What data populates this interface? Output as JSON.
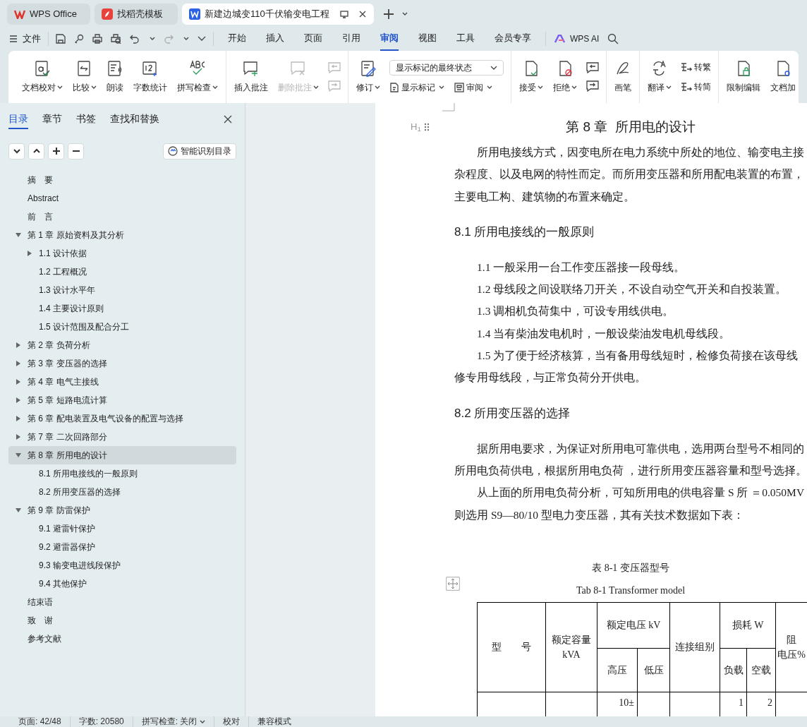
{
  "tabs": [
    {
      "label": "WPS Office",
      "kind": "home",
      "selected": false
    },
    {
      "label": "找稻壳模板",
      "kind": "template",
      "selected": false
    },
    {
      "label": "新建边城变110千伏输变电工程",
      "kind": "document",
      "selected": true
    }
  ],
  "menu": {
    "file": "文件",
    "ribbon_tabs": [
      {
        "label": "开始",
        "selected": false
      },
      {
        "label": "插入",
        "selected": false
      },
      {
        "label": "页面",
        "selected": false
      },
      {
        "label": "引用",
        "selected": false
      },
      {
        "label": "审阅",
        "selected": true
      },
      {
        "label": "视图",
        "selected": false
      },
      {
        "label": "工具",
        "selected": false
      },
      {
        "label": "会员专享",
        "selected": false
      }
    ],
    "ai": "WPS AI"
  },
  "ribbon": [
    {
      "items": [
        {
          "kind": "large",
          "label": "文档校对",
          "dropdown": true,
          "disabled": false
        },
        {
          "kind": "large",
          "label": "比较",
          "dropdown": true,
          "disabled": false
        },
        {
          "kind": "large",
          "label": "朗读",
          "dropdown": false,
          "disabled": false
        },
        {
          "kind": "large",
          "label": "字数统计",
          "dropdown": false,
          "disabled": false
        },
        {
          "kind": "large",
          "label": "拼写检查",
          "dropdown": true,
          "disabled": false
        }
      ]
    },
    {
      "items": [
        {
          "kind": "large",
          "label": "插入批注",
          "dropdown": false,
          "disabled": false
        },
        {
          "kind": "large",
          "label": "删除批注",
          "dropdown": true,
          "disabled": true
        },
        {
          "kind": "pair",
          "disabled": true
        }
      ]
    },
    {
      "items": [
        {
          "kind": "large",
          "label": "修订",
          "dropdown": true,
          "disabled": false
        },
        {
          "kind": "stack",
          "select": "显示标记的最终状态",
          "buttons": [
            {
              "label": "显示标记"
            },
            {
              "label": "审阅"
            }
          ]
        }
      ]
    },
    {
      "items": [
        {
          "kind": "large",
          "label": "接受",
          "dropdown": true,
          "disabled": false
        },
        {
          "kind": "large",
          "label": "拒绝",
          "dropdown": true,
          "disabled": false
        },
        {
          "kind": "pair",
          "disabled": false
        }
      ]
    },
    {
      "items": [
        {
          "kind": "large",
          "label": "画笔",
          "dropdown": false,
          "disabled": false
        }
      ]
    },
    {
      "items": [
        {
          "kind": "large",
          "label": "翻译",
          "dropdown": true,
          "disabled": false
        },
        {
          "kind": "stack2",
          "buttons": [
            {
              "label": "转繁"
            },
            {
              "label": "转简"
            }
          ]
        }
      ]
    },
    {
      "items": [
        {
          "kind": "large",
          "label": "限制编辑",
          "dropdown": false,
          "disabled": false
        },
        {
          "kind": "large",
          "label": "文档加",
          "dropdown": false,
          "disabled": false
        }
      ]
    }
  ],
  "sidebar": {
    "tabs": [
      {
        "label": "目录",
        "selected": true
      },
      {
        "label": "章节",
        "selected": false
      },
      {
        "label": "书签",
        "selected": false
      },
      {
        "label": "查找和替换",
        "selected": false
      }
    ],
    "smart_button": "智能识别目录",
    "toc": [
      {
        "label": "摘　要",
        "selected": false
      },
      {
        "label": "Abstract",
        "selected": false
      },
      {
        "label": "前　言",
        "selected": false
      },
      {
        "label": "第 1 章  原始资料及其分析",
        "selected": false,
        "expanded": true,
        "children": [
          {
            "label": "1.1 设计依据",
            "selected": false,
            "expanded": false
          },
          {
            "label": "1.2 工程概况",
            "selected": false
          },
          {
            "label": "1.3 设计水平年",
            "selected": false
          },
          {
            "label": "1.4  主要设计原则",
            "selected": false
          },
          {
            "label": "1.5 设计范围及配合分工",
            "selected": false
          }
        ]
      },
      {
        "label": "第 2 章  负荷分析",
        "selected": false,
        "expanded": false
      },
      {
        "label": "第 3 章  变压器的选择",
        "selected": false,
        "expanded": false
      },
      {
        "label": "第 4 章  电气主接线",
        "selected": false,
        "expanded": false
      },
      {
        "label": "第 5 章  短路电流计算",
        "selected": false,
        "expanded": false
      },
      {
        "label": "第 6 章  配电装置及电气设备的配置与选择",
        "selected": false,
        "expanded": false
      },
      {
        "label": "第 7 章  二次回路部分",
        "selected": false,
        "expanded": false
      },
      {
        "label": "第 8 章  所用电的设计",
        "selected": true,
        "expanded": true,
        "children": [
          {
            "label": "8.1 所用电接线的一般原则",
            "selected": false
          },
          {
            "label": "8.2 所用变压器的选择",
            "selected": false
          }
        ]
      },
      {
        "label": "第 9 章  防雷保护",
        "selected": false,
        "expanded": true,
        "children": [
          {
            "label": "9.1 避雷针保护",
            "selected": false
          },
          {
            "label": "9.2 避雷器保护",
            "selected": false
          },
          {
            "label": "9.3 输变电进线段保护",
            "selected": false
          },
          {
            "label": "9.4 其他保护",
            "selected": false
          }
        ]
      },
      {
        "label": "结束语",
        "selected": false
      },
      {
        "label": "致　谢",
        "selected": false
      },
      {
        "label": "参考文献",
        "selected": false
      }
    ]
  },
  "document": {
    "heading_marker": "H$_{1}$",
    "title": "第 8 章  所用电的设计",
    "blocks": [
      {
        "kind": "para",
        "lines": [
          "所用电接线方式，因变电所在电力系统中所处的地位、输变电主接",
          "杂程度、以及电网的特性而定。而所用变压器和所用配电装置的布置，",
          "主要电工构、建筑物的布置来确定。"
        ]
      },
      {
        "kind": "heading",
        "text": "8.1 所用电接线的一般原则"
      },
      {
        "kind": "para",
        "lines": [
          "1.1 一般采用一台工作变压器接一段母线。"
        ]
      },
      {
        "kind": "para",
        "lines": [
          "1.2 母线段之间设联络刀开关，不设自动空气开关和自投装置。"
        ]
      },
      {
        "kind": "para",
        "lines": [
          "1.3 调相机负荷集中，可设专用线供电。"
        ]
      },
      {
        "kind": "para",
        "lines": [
          "1.4 当有柴油发电机时，一般设柴油发电机母线段。"
        ]
      },
      {
        "kind": "para",
        "lines": [
          "1.5 为了便于经济核算，当有备用母线短时，检修负荷接在该母线",
          "修专用母线段，与正常负荷分开供电。"
        ]
      },
      {
        "kind": "heading",
        "text": "8.2 所用变压器的选择"
      },
      {
        "kind": "para",
        "lines": [
          "据所用电要求，为保证对所用电可靠供电，选用两台型号不相同的",
          "所用电负荷供电，根据所用电负荷 ，进行所用变压器容量和型号选择。"
        ]
      },
      {
        "kind": "para",
        "lines": [
          "从上面的所用电负荷分析，可知所用电的供电容量 S 所 ＝0.050MV",
          "则选用 S9—80/10 型电力变压器，其有关技术数据如下表："
        ]
      }
    ],
    "table_caption": "表 8-1 变压器型号",
    "table_caption_en": "Tab 8-1 Transformer model",
    "table": {
      "header_top": [
        {
          "lines": [
            "型　　号"
          ],
          "kind": "tall"
        },
        {
          "lines": [
            "额定容量 kVA"
          ],
          "kind": "tall"
        },
        {
          "lines": [
            "额定电压 kV"
          ],
          "kind": "wide"
        },
        {
          "lines": [
            "连接组别"
          ],
          "kind": "tall"
        },
        {
          "lines": [
            "损耗 W"
          ],
          "kind": "wide"
        },
        {
          "lines": [
            "阻",
            "电压%"
          ],
          "kind": "tall"
        }
      ],
      "header_bottom": [
        "高压",
        "低压",
        "负载",
        "空载"
      ],
      "row": {
        "column_3": "10±",
        "column_6": "1",
        "column_7": "2"
      }
    }
  },
  "status_bar": [
    {
      "text": "页面: 42/48",
      "dropdown": false
    },
    {
      "text": "字数: 20580",
      "dropdown": false
    },
    {
      "text": "拼写检查: 关闭",
      "dropdown": true
    },
    {
      "text": "校对",
      "dropdown": false
    },
    {
      "text": "兼容模式",
      "dropdown": false
    }
  ]
}
